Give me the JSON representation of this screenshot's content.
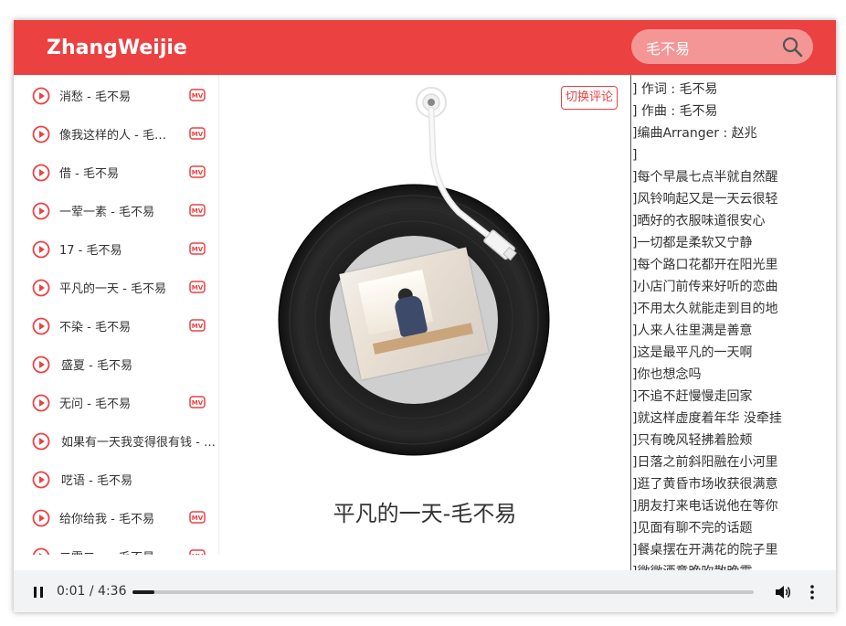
{
  "app": {
    "logo": "ZhangWeijie"
  },
  "search": {
    "value": "毛不易"
  },
  "playlist": [
    {
      "title": "消愁 - 毛不易",
      "mv": true
    },
    {
      "title": "像我这样的人 - 毛不易",
      "mv": true
    },
    {
      "title": "借 - 毛不易",
      "mv": true
    },
    {
      "title": "一荤一素 - 毛不易",
      "mv": true
    },
    {
      "title": "17 - 毛不易",
      "mv": true
    },
    {
      "title": "平凡的一天 - 毛不易",
      "mv": true
    },
    {
      "title": "不染 - 毛不易",
      "mv": true
    },
    {
      "title": "盛夏 - 毛不易",
      "mv": false
    },
    {
      "title": "无问 - 毛不易",
      "mv": true
    },
    {
      "title": "如果有一天我变得很有钱 - 毛不易",
      "mv": false
    },
    {
      "title": "呓语 - 毛不易",
      "mv": false
    },
    {
      "title": "给你给我 - 毛不易",
      "mv": true
    },
    {
      "title": "二零二一 - 毛不易",
      "mv": true
    }
  ],
  "stage": {
    "switch_label": "切换评论",
    "song_name": "平凡的一天-毛不易"
  },
  "lyrics": [
    "] 作词 : 毛不易",
    "] 作曲 : 毛不易",
    "]编曲Arranger : 赵兆",
    "]",
    "]每个早晨七点半就自然醒",
    "]风铃响起又是一天云很轻",
    "]晒好的衣服味道很安心",
    "]一切都是柔软又宁静",
    "]每个路口花都开在阳光里",
    "]小店门前传来好听的恋曲",
    "]不用太久就能走到目的地",
    "]人来人往里满是善意",
    "]这是最平凡的一天啊",
    "]你也想念吗",
    "]不追不赶慢慢走回家",
    "]就这样虚度着年华 没牵挂",
    "]只有晚风轻拂着脸颊",
    "]日落之前斜阳融在小河里",
    "]逛了黄昏市场收获很满意",
    "]朋友打来电话说他在等你",
    "]见面有聊不完的话题",
    "]餐桌摆在开满花的院子里",
    "]微微酒意晚吹散晚霞"
  ],
  "player": {
    "time": "0:01 / 4:36",
    "progress": 0.036
  },
  "colors": {
    "accent": "#ec4141"
  }
}
